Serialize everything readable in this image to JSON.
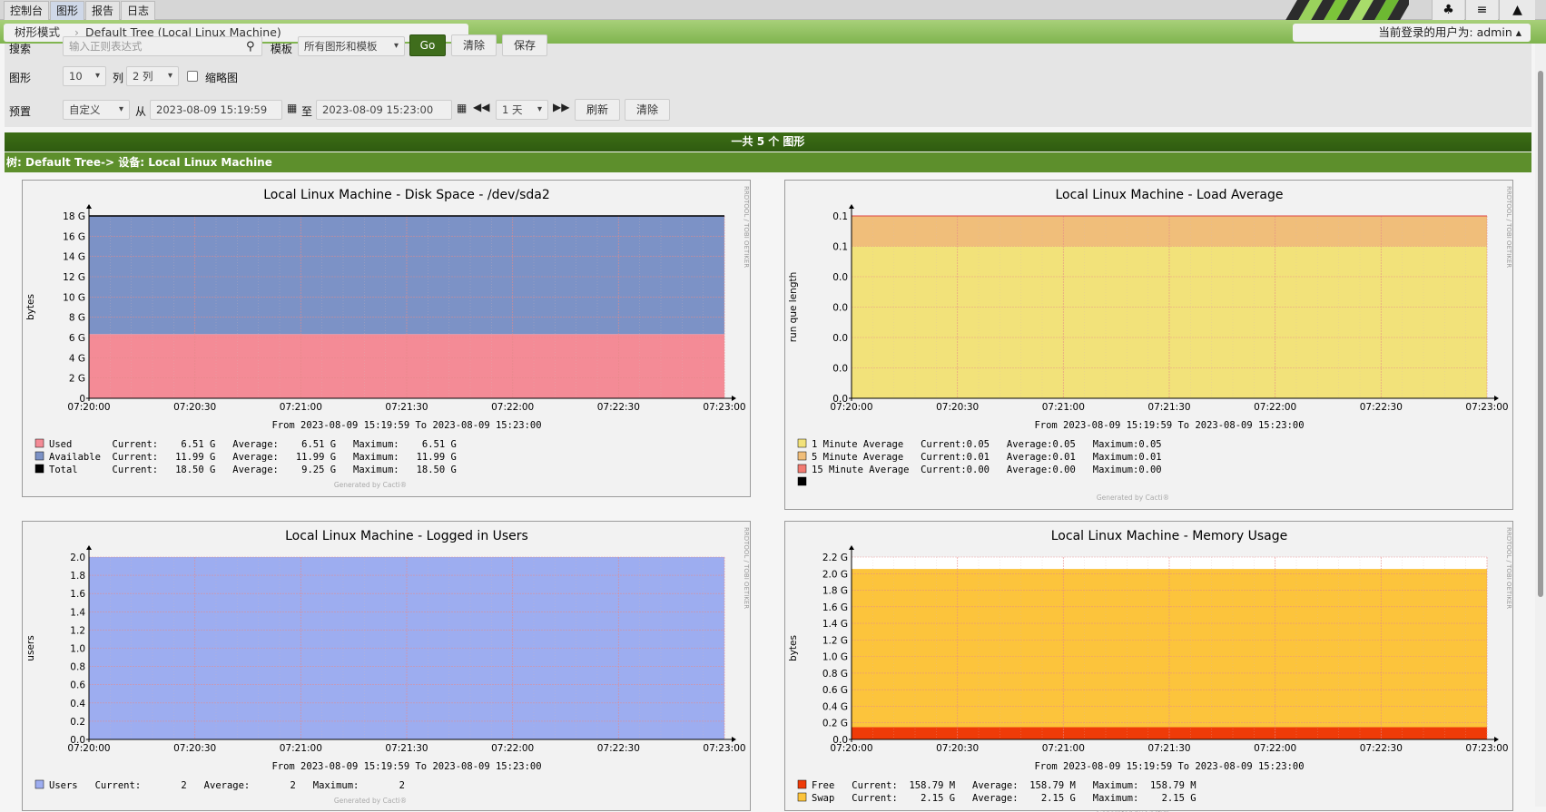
{
  "tabs": [
    {
      "label": "控制台",
      "active": false
    },
    {
      "label": "图形",
      "active": true
    },
    {
      "label": "报告",
      "active": false
    },
    {
      "label": "日志",
      "active": false
    }
  ],
  "breadcrumb": {
    "mode": "树形模式",
    "current": "Default Tree (Local Linux Machine)"
  },
  "user_info": "当前登录的用户为: admin ▴",
  "filters": {
    "search_label": "搜索",
    "search_placeholder": "输入正则表达式",
    "template_label": "模板",
    "template_value": "所有图形和模板",
    "go_label": "Go",
    "clear_label": "清除",
    "save_label": "保存",
    "graphs_label": "图形",
    "graphs_value": "10",
    "columns_label": "列",
    "columns_value": "2 列",
    "thumbnail_label": "缩略图",
    "preset_label": "预置",
    "preset_value": "自定义",
    "from_label": "从",
    "from_value": "2023-08-09 15:19:59",
    "to_label": "至",
    "to_value": "2023-08-09 15:23:00",
    "span_value": "1 天",
    "refresh_label": "刷新",
    "clear2_label": "清除"
  },
  "total_bar": "一共 5 个 图形",
  "tree_bar": "树: Default Tree-> 设备: Local Linux Machine",
  "rrd_side_text": "RRDTOOL / TOBI OETIKER",
  "generated_text": "Generated by Cacti®",
  "chart_data": [
    {
      "type": "area",
      "title": "Local Linux Machine - Disk Space - /dev/sda2",
      "ylabel": "bytes",
      "x": [
        "07:20:00",
        "07:20:30",
        "07:21:00",
        "07:21:30",
        "07:22:00",
        "07:22:30",
        "07:23:00"
      ],
      "yticks": [
        "0",
        "2 G",
        "4 G",
        "6 G",
        "8 G",
        "10 G",
        "12 G",
        "14 G",
        "16 G",
        "18 G"
      ],
      "ylim": [
        0,
        18.5
      ],
      "subtitle": "From 2023-08-09 15:19:59 To 2023-08-09 15:23:00",
      "series": [
        {
          "name": "Used",
          "value": 6.51,
          "color": "#f48b96"
        },
        {
          "name": "Available",
          "value": 11.99,
          "color": "#7c92c6"
        },
        {
          "name": "Total",
          "value": 18.5,
          "color": "#000000"
        }
      ],
      "legend": [
        {
          "name": "Used",
          "text": "Used       Current:    6.51 G   Average:    6.51 G   Maximum:    6.51 G",
          "color": "#f48b96"
        },
        {
          "name": "Available",
          "text": "Available  Current:   11.99 G   Average:   11.99 G   Maximum:   11.99 G",
          "color": "#7c92c6"
        },
        {
          "name": "Total",
          "text": "Total      Current:   18.50 G   Average:    9.25 G   Maximum:   18.50 G",
          "color": "#000000"
        }
      ]
    },
    {
      "type": "area",
      "title": "Local Linux Machine - Load Average",
      "ylabel": "run que length",
      "x": [
        "07:20:00",
        "07:20:30",
        "07:21:00",
        "07:21:30",
        "07:22:00",
        "07:22:30",
        "07:23:00"
      ],
      "yticks": [
        "0.0",
        "0.0",
        "0.0",
        "0.0",
        "0.0",
        "0.1",
        "0.1"
      ],
      "ylim": [
        0,
        0.06
      ],
      "subtitle": "From 2023-08-09 15:19:59 To 2023-08-09 15:23:00",
      "series": [
        {
          "name": "1 Minute Average",
          "value": 0.05,
          "color": "#f2e27a"
        },
        {
          "name": "5 Minute Average",
          "value": 0.01,
          "color": "#f0be7a"
        },
        {
          "name": "15 Minute Average",
          "value": 0.0,
          "color": "#f27b72"
        }
      ],
      "legend": [
        {
          "name": "1 Minute Average",
          "text": "1 Minute Average   Current:0.05   Average:0.05   Maximum:0.05",
          "color": "#f2e27a"
        },
        {
          "name": "5 Minute Average",
          "text": "5 Minute Average   Current:0.01   Average:0.01   Maximum:0.01",
          "color": "#f0be7a"
        },
        {
          "name": "15 Minute Average",
          "text": "15 Minute Average  Current:0.00   Average:0.00   Maximum:0.00",
          "color": "#f27b72"
        },
        {
          "name": "",
          "text": "",
          "color": "#000000"
        }
      ]
    },
    {
      "type": "area",
      "title": "Local Linux Machine - Logged in Users",
      "ylabel": "users",
      "x": [
        "07:20:00",
        "07:20:30",
        "07:21:00",
        "07:21:30",
        "07:22:00",
        "07:22:30",
        "07:23:00"
      ],
      "yticks": [
        "0.0",
        "0.2",
        "0.4",
        "0.6",
        "0.8",
        "1.0",
        "1.2",
        "1.4",
        "1.6",
        "1.8",
        "2.0"
      ],
      "ylim": [
        0,
        2.0
      ],
      "subtitle": "From 2023-08-09 15:19:59 To 2023-08-09 15:23:00",
      "series": [
        {
          "name": "Users",
          "value": 2,
          "color": "#9dadf0"
        }
      ],
      "legend": [
        {
          "name": "Users",
          "text": "Users   Current:       2   Average:       2   Maximum:       2",
          "color": "#9dadf0"
        }
      ]
    },
    {
      "type": "area",
      "title": "Local Linux Machine - Memory Usage",
      "ylabel": "bytes",
      "x": [
        "07:20:00",
        "07:20:30",
        "07:21:00",
        "07:21:30",
        "07:22:00",
        "07:22:30",
        "07:23:00"
      ],
      "yticks": [
        "0.0",
        "0.2 G",
        "0.4 G",
        "0.6 G",
        "0.8 G",
        "1.0 G",
        "1.2 G",
        "1.4 G",
        "1.6 G",
        "1.8 G",
        "2.0 G",
        "2.2 G"
      ],
      "ylim": [
        0,
        2.3
      ],
      "subtitle": "From 2023-08-09 15:19:59 To 2023-08-09 15:23:00",
      "series": [
        {
          "name": "Free",
          "value": 0.155,
          "color": "#ef3b08"
        },
        {
          "name": "Swap",
          "value": 2.15,
          "color": "#fcc43c"
        }
      ],
      "legend": [
        {
          "name": "Free",
          "text": "Free   Current:  158.79 M   Average:  158.79 M   Maximum:  158.79 M",
          "color": "#ef3b08"
        },
        {
          "name": "Swap",
          "text": "Swap   Current:    2.15 G   Average:    2.15 G   Maximum:    2.15 G",
          "color": "#fcc43c"
        }
      ]
    }
  ]
}
